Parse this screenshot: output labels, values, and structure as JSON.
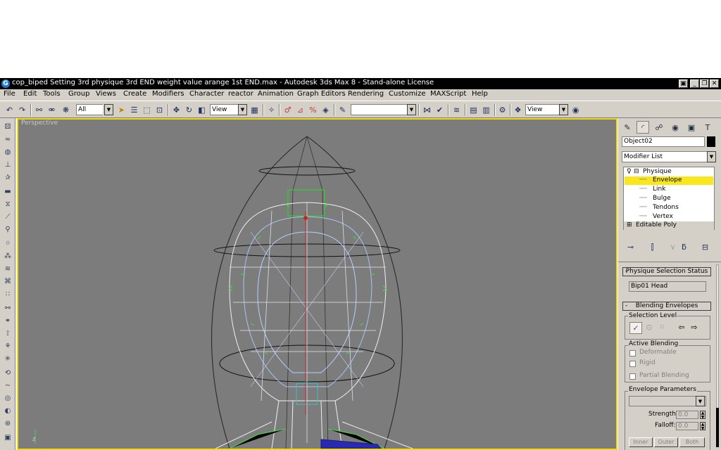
{
  "window": {
    "title": "cop_biped Setting 3rd physique 3rd END weight value arange 1st END.max - Autodesk 3ds Max 8  - Stand-alone License",
    "app_icon": "G"
  },
  "menu": [
    "File",
    "Edit",
    "Tools",
    "Group",
    "Views",
    "Create",
    "Modifiers",
    "Character",
    "reactor",
    "Animation",
    "Graph Editors",
    "Rendering",
    "Customize",
    "MAXScript",
    "Help"
  ],
  "toolbar": {
    "selection_filter": "All",
    "reference_coord": "View",
    "named_selection": "",
    "view_combo": "View"
  },
  "viewport": {
    "label": "Perspective",
    "axis_label": "z"
  },
  "command_panel": {
    "object_name": "Object02",
    "modifier_list": "Modifier List",
    "stack": {
      "modifier": "Physique",
      "subobjects": [
        "Envelope",
        "Link",
        "Bulge",
        "Tendons",
        "Vertex"
      ],
      "selected": "Envelope",
      "base": "Editable Poly"
    },
    "physique_selection_status": {
      "title": "Physique Selection Status",
      "value": "Bip01 Head"
    },
    "blending_envelopes": {
      "title": "Blending Envelopes",
      "selection_level_label": "Selection Level",
      "active_blending_label": "Active Blending",
      "checkboxes": [
        "Deformable",
        "Rigid",
        "Partial Blending"
      ],
      "envelope_parameters_label": "Envelope Parameters",
      "strength_label": "Strength:",
      "strength_value": "0.0",
      "falloff_label": "Falloff:",
      "falloff_value": "0.0",
      "buttons": [
        "Inner",
        "Outer",
        "Both"
      ]
    },
    "colors": {
      "highlight": "#fae61e",
      "viewport_border": "#f1d816"
    }
  }
}
